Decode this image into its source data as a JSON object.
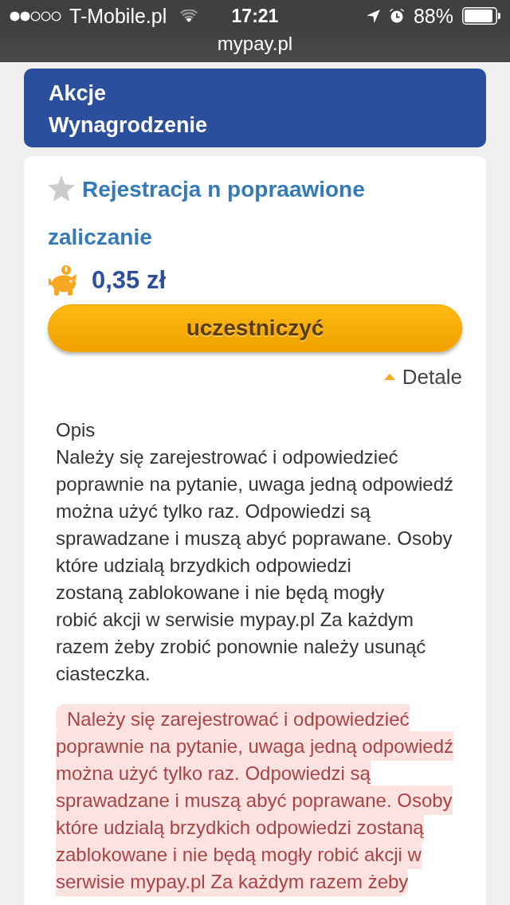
{
  "status_bar": {
    "carrier": "T-Mobile.pl",
    "time": "17:21",
    "battery": "88%"
  },
  "address_bar": {
    "url": "mypay.pl"
  },
  "nav": {
    "items": [
      {
        "label": "Akcje"
      },
      {
        "label": "Wynagrodzenie"
      }
    ]
  },
  "action": {
    "title": "Rejestracja n popraawione zaliczanie",
    "reward": "0,35 zł",
    "button": "uczestniczyć",
    "details": {
      "label": "Detale",
      "expanded": true
    },
    "description": {
      "heading": "Opis",
      "text": "Należy się zarejestrować i odpowiedzieć\npoprawnie na pytanie, uwaga jedną odpowiedź\nmożna użyć tylko raz. Odpowiedzi są\nsprawadzane i muszą abyć poprawane. Osoby\nktóre udzialą brzydkich odpowiedzi\nzostaną zablokowane i nie będą mogły\nrobić akcji w serwisie mypay.pl Za każdym\nrazem żeby zrobić ponownie należy usunąć\nciasteczka."
    },
    "warning": "Należy się zarejestrować i odpowiedzieć\npoprawnie na pytanie, uwaga jedną odpowiedź\nmożna użyć tylko raz. Odpowiedzi są\nsprawadzane i muszą abyć poprawane. Osoby\nktóre udzialą brzydkich odpowiedzi zostaną\nzablokowane i nie będą mogły robić akcji w\nserwisie mypay.pl Za każdym razem żeby"
  }
}
